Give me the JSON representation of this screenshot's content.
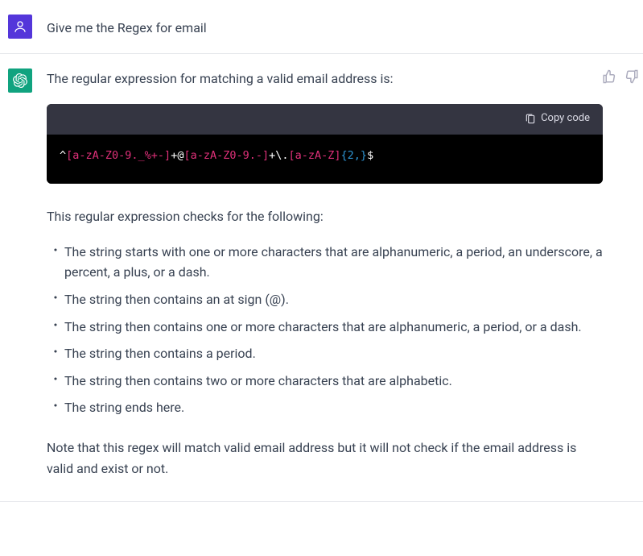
{
  "user_message": "Give me the Regex for email",
  "assistant": {
    "intro": "The regular expression for matching a valid email address is:",
    "code_tokens": [
      {
        "t": "^",
        "c": "white"
      },
      {
        "t": "[a-zA-Z0-9._%+-]",
        "c": "pink"
      },
      {
        "t": "+@",
        "c": "white"
      },
      {
        "t": "[a-zA-Z0-9.-]",
        "c": "pink"
      },
      {
        "t": "+\\.",
        "c": "white"
      },
      {
        "t": "[a-zA-Z]",
        "c": "pink"
      },
      {
        "t": "{2,}",
        "c": "blue"
      },
      {
        "t": "$",
        "c": "white"
      }
    ],
    "copy_label": "Copy code",
    "explain_intro": "This regular expression checks for the following:",
    "explain_items": [
      "The string starts with one or more characters that are alphanumeric, a period, an underscore, a percent, a plus, or a dash.",
      "The string then contains an at sign (@).",
      "The string then contains one or more characters that are alphanumeric, a period, or a dash.",
      "The string then contains a period.",
      "The string then contains two or more characters that are alphabetic.",
      "The string ends here."
    ],
    "note": "Note that this regex will match valid email address but it will not check if the email address is valid and exist or not."
  }
}
